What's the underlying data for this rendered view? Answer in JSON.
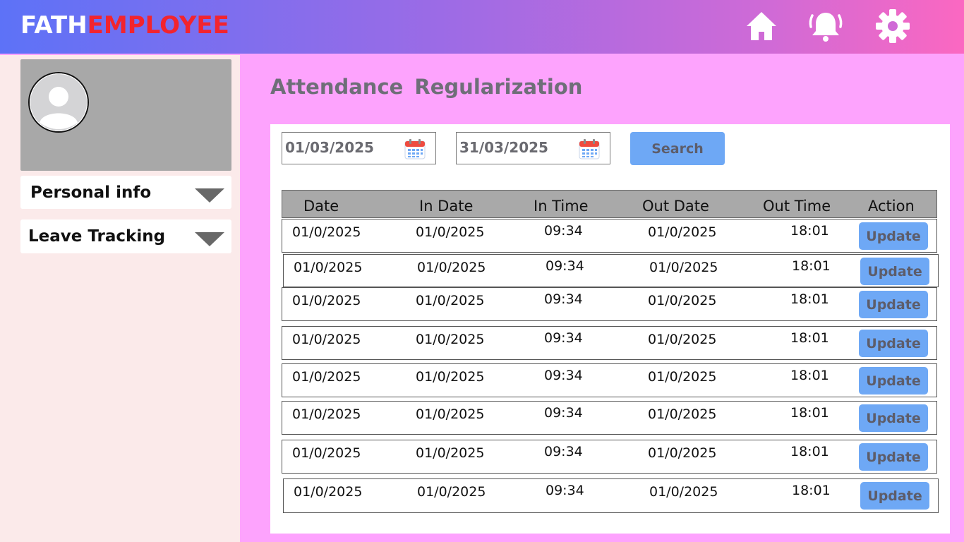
{
  "brand": {
    "part1": "FATH",
    "part2": "EMPLOYEE"
  },
  "header": {
    "icons": [
      "home-icon",
      "bell-icon",
      "gear-icon"
    ]
  },
  "sidebar": {
    "items": [
      {
        "label": "Personal info"
      },
      {
        "label": "Leave Tracking"
      }
    ]
  },
  "page": {
    "title": "Attendance  Regularization"
  },
  "filters": {
    "from_date": "01/03/2025",
    "to_date": "31/03/2025",
    "search_label": "Search"
  },
  "table": {
    "columns": [
      "Date",
      "In Date",
      "In Time",
      "Out Date",
      "Out Time",
      "Action"
    ],
    "rows": [
      {
        "date": "01/0/2025",
        "in_date": "01/0/2025",
        "in_time": "09:34",
        "out_date": "01/0/2025",
        "out_time": "18:01",
        "action": "Update"
      },
      {
        "date": "01/0/2025",
        "in_date": "01/0/2025",
        "in_time": "09:34",
        "out_date": "01/0/2025",
        "out_time": "18:01",
        "action": "Update"
      },
      {
        "date": "01/0/2025",
        "in_date": "01/0/2025",
        "in_time": "09:34",
        "out_date": "01/0/2025",
        "out_time": "18:01",
        "action": "Update"
      },
      {
        "date": "01/0/2025",
        "in_date": "01/0/2025",
        "in_time": "09:34",
        "out_date": "01/0/2025",
        "out_time": "18:01",
        "action": "Update"
      },
      {
        "date": "01/0/2025",
        "in_date": "01/0/2025",
        "in_time": "09:34",
        "out_date": "01/0/2025",
        "out_time": "18:01",
        "action": "Update"
      },
      {
        "date": "01/0/2025",
        "in_date": "01/0/2025",
        "in_time": "09:34",
        "out_date": "01/0/2025",
        "out_time": "18:01",
        "action": "Update"
      },
      {
        "date": "01/0/2025",
        "in_date": "01/0/2025",
        "in_time": "09:34",
        "out_date": "01/0/2025",
        "out_time": "18:01",
        "action": "Update"
      },
      {
        "date": "01/0/2025",
        "in_date": "01/0/2025",
        "in_time": "09:34",
        "out_date": "01/0/2025",
        "out_time": "18:01",
        "action": "Update"
      }
    ]
  },
  "colors": {
    "brand_accent": "#f2242e",
    "button": "#6ea8f5",
    "content_bg": "#fda3fd",
    "sidebar_bg": "#fbeaea"
  }
}
